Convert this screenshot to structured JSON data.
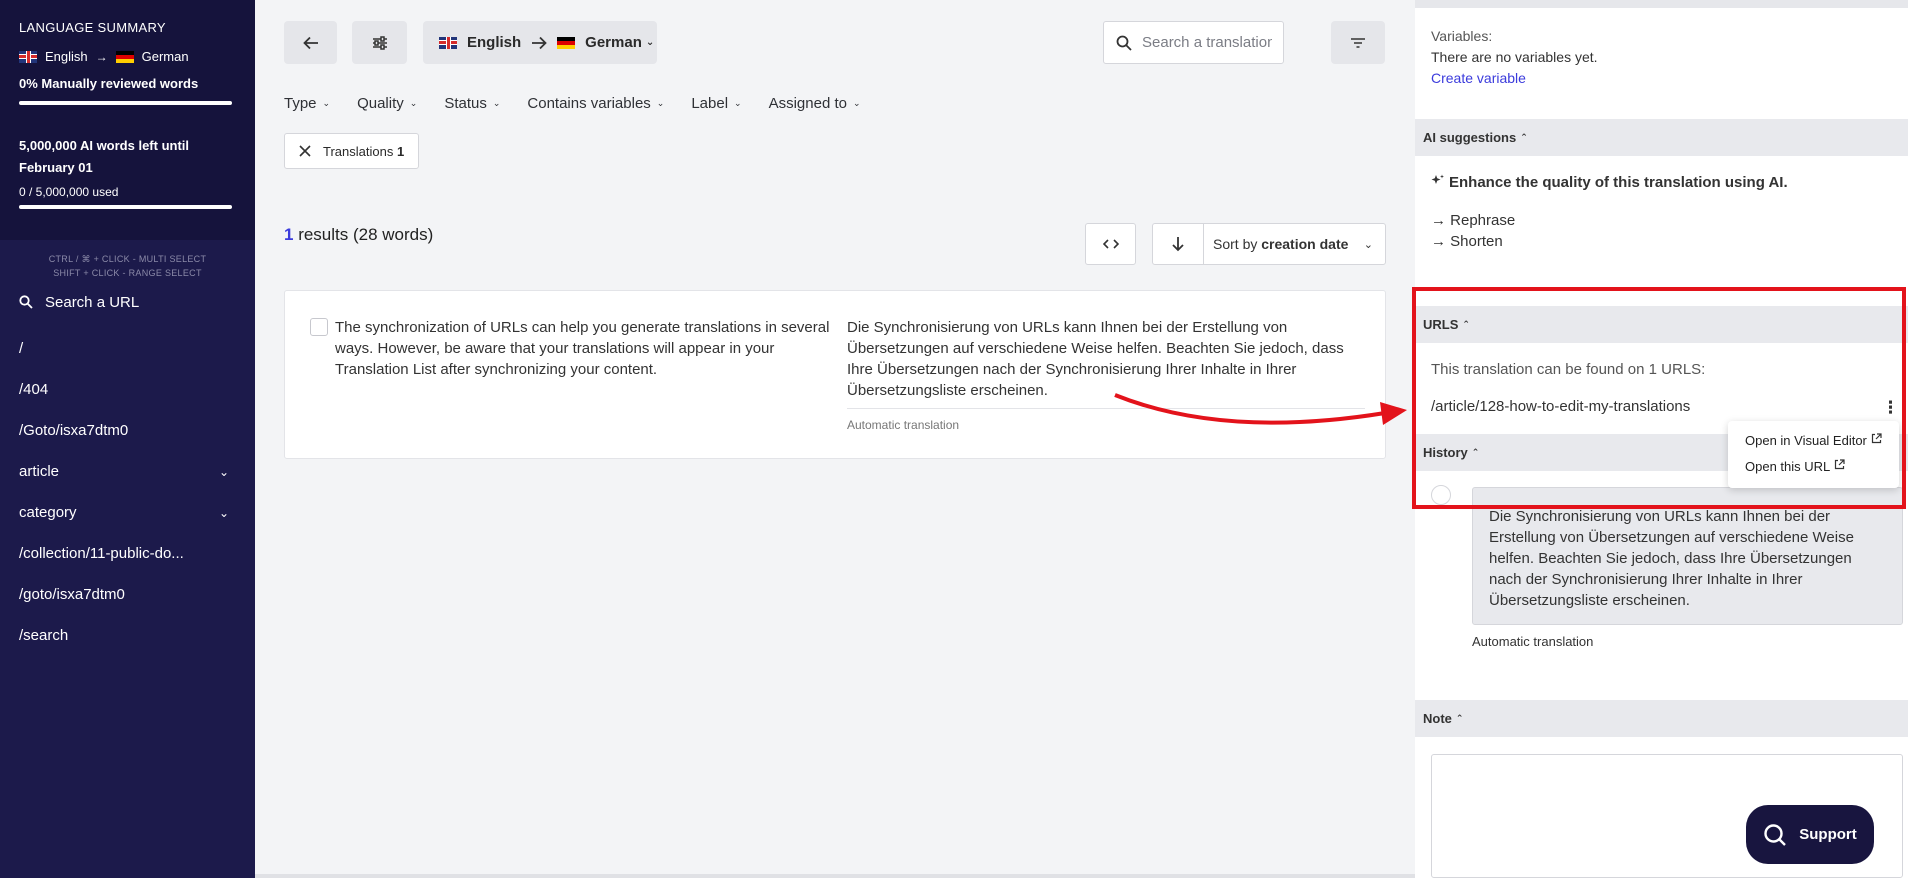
{
  "sidebar": {
    "heading": "LANGUAGE SUMMARY",
    "source_lang": "English",
    "target_lang": "German",
    "reviewed": "0% Manually reviewed words",
    "reviewed_progress": 1.0,
    "ai_words_line1": "5,000,000 AI words left until",
    "ai_words_line2": "February 01",
    "ai_used": "0 / 5,000,000 used",
    "ai_progress": 1.0,
    "hint_multi": "CTRL / ⌘ + CLICK - MULTI SELECT",
    "hint_range": "SHIFT + CLICK - RANGE SELECT",
    "search_label": "Search a URL",
    "items": [
      {
        "label": "/",
        "expandable": false
      },
      {
        "label": "/404",
        "expandable": false
      },
      {
        "label": "/Goto/isxa7dtm0",
        "expandable": false
      },
      {
        "label": "article",
        "expandable": true
      },
      {
        "label": "category",
        "expandable": true
      },
      {
        "label": "/collection/11-public-do...",
        "expandable": false
      },
      {
        "label": "/goto/isxa7dtm0",
        "expandable": false
      },
      {
        "label": "/search",
        "expandable": false
      }
    ]
  },
  "toolbar": {
    "source_lang": "English",
    "target_lang": "German",
    "search_placeholder": "Search a translation"
  },
  "filters": [
    "Type",
    "Quality",
    "Status",
    "Contains variables",
    "Label",
    "Assigned to"
  ],
  "chip": {
    "label": "Translations",
    "count": "1"
  },
  "results": {
    "count": "1",
    "text": " results (28 words)"
  },
  "sort": {
    "prefix": "Sort by ",
    "field": "creation date"
  },
  "translation": {
    "source": "The synchronization of URLs can help you generate translations in several ways. However, be aware that your translations will appear in your Translation List after synchronizing your content.",
    "target": "Die Synchronisierung von URLs kann Ihnen bei der Erstellung von Übersetzungen auf verschiedene Weise helfen. Beachten Sie jedoch, dass Ihre Übersetzungen nach der Synchronisierung Ihrer Inhalte in Ihrer Übersetzungsliste erscheinen.",
    "meta": "Automatic translation"
  },
  "panel": {
    "variables_label": "Variables:",
    "variables_empty": "There are no variables yet.",
    "create_variable": "Create variable",
    "ai_header": "AI suggestions",
    "ai_title": "Enhance the quality of this translation using AI.",
    "ai_rephrase": "→ Rephrase",
    "ai_shorten": "→ Shorten",
    "urls_header": "URLS",
    "urls_note": "This translation can be found on 1 URLS:",
    "url": "/article/128-how-to-edit-my-translations",
    "history_header": "History",
    "history_text": "Die Synchronisierung von URLs kann Ihnen bei der Erstellung von Übersetzungen auf verschiedene Weise helfen. Beachten Sie jedoch, dass Ihre Übersetzungen nach der Synchronisierung Ihrer Inhalte in Ihrer Übersetzungsliste erscheinen.",
    "history_meta": "Automatic translation",
    "note_header": "Note"
  },
  "popup": {
    "open_visual_editor": "Open in Visual Editor",
    "open_url": "Open this URL"
  },
  "support": "Support",
  "colors": {
    "sidebar": "#1c1a4b",
    "accent": "#3b3bdc",
    "highlight": "#e3131b"
  }
}
